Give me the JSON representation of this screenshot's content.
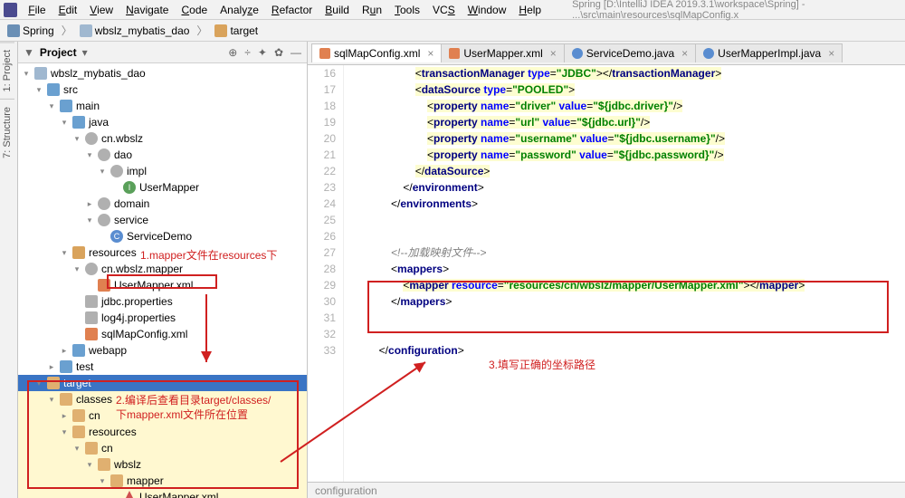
{
  "window_title": "Spring [D:\\IntelliJ IDEA 2019.3.1\\workspace\\Spring] - ...\\src\\main\\resources\\sqlMapConfig.x",
  "menu": [
    "File",
    "Edit",
    "View",
    "Navigate",
    "Code",
    "Analyze",
    "Refactor",
    "Build",
    "Run",
    "Tools",
    "VCS",
    "Window",
    "Help"
  ],
  "breadcrumb": [
    {
      "icon": "ic-project",
      "label": "Spring"
    },
    {
      "icon": "ic-module",
      "label": "wbslz_mybatis_dao"
    },
    {
      "icon": "ic-folder",
      "label": "target"
    }
  ],
  "sidebar_tabs": [
    "1: Project",
    "7: Structure"
  ],
  "project_panel": {
    "title": "Project",
    "tools": [
      "⊕",
      "÷",
      "✦",
      "✿",
      "—"
    ]
  },
  "tree": [
    {
      "d": 0,
      "a": "▾",
      "i": "ic-module",
      "t": "wbslz_mybatis_dao"
    },
    {
      "d": 1,
      "a": "▾",
      "i": "ic-folder-blue",
      "t": "src"
    },
    {
      "d": 2,
      "a": "▾",
      "i": "ic-folder-blue",
      "t": "main"
    },
    {
      "d": 3,
      "a": "▾",
      "i": "ic-folder-blue",
      "t": "java"
    },
    {
      "d": 4,
      "a": "▾",
      "i": "ic-pkg",
      "t": "cn.wbslz"
    },
    {
      "d": 5,
      "a": "▾",
      "i": "ic-pkg",
      "t": "dao"
    },
    {
      "d": 6,
      "a": "▾",
      "i": "ic-pkg",
      "t": "impl"
    },
    {
      "d": 7,
      "a": "",
      "i": "ic-if",
      "it": "I",
      "t": "UserMapper"
    },
    {
      "d": 5,
      "a": "▸",
      "i": "ic-pkg",
      "t": "domain"
    },
    {
      "d": 5,
      "a": "▾",
      "i": "ic-pkg",
      "t": "service"
    },
    {
      "d": 6,
      "a": "",
      "i": "ic-class",
      "it": "C",
      "t": "ServiceDemo"
    },
    {
      "d": 3,
      "a": "▾",
      "i": "ic-folder",
      "t": "resources"
    },
    {
      "d": 4,
      "a": "▾",
      "i": "ic-pkg",
      "t": "cn.wbslz.mapper"
    },
    {
      "d": 5,
      "a": "",
      "i": "ic-xml",
      "t": "UserMapper.xml",
      "box": true
    },
    {
      "d": 4,
      "a": "",
      "i": "ic-props",
      "t": "jdbc.properties"
    },
    {
      "d": 4,
      "a": "",
      "i": "ic-props",
      "t": "log4j.properties"
    },
    {
      "d": 4,
      "a": "",
      "i": "ic-xml",
      "t": "sqlMapConfig.xml"
    },
    {
      "d": 3,
      "a": "▸",
      "i": "ic-folder-blue",
      "t": "webapp"
    },
    {
      "d": 2,
      "a": "▸",
      "i": "ic-folder-blue",
      "t": "test"
    },
    {
      "d": 1,
      "a": "▾",
      "i": "ic-folder-open",
      "t": "target",
      "sel": true
    },
    {
      "d": 2,
      "a": "▾",
      "i": "ic-folder-open",
      "t": "classes",
      "hl": true
    },
    {
      "d": 3,
      "a": "▸",
      "i": "ic-folder-open",
      "t": "cn",
      "hl": true
    },
    {
      "d": 3,
      "a": "▾",
      "i": "ic-folder-open",
      "t": "resources",
      "hl": true
    },
    {
      "d": 4,
      "a": "▾",
      "i": "ic-folder-open",
      "t": "cn",
      "hl": true
    },
    {
      "d": 5,
      "a": "▾",
      "i": "ic-folder-open",
      "t": "wbslz",
      "hl": true
    },
    {
      "d": 6,
      "a": "▾",
      "i": "ic-folder-open",
      "t": "mapper",
      "hl": true
    },
    {
      "d": 7,
      "a": "",
      "i": "ic-err",
      "t": "UserMapper.xml",
      "hl": true
    }
  ],
  "editor_tabs": [
    {
      "icon": "ic-xml",
      "label": "sqlMapConfig.xml",
      "active": true
    },
    {
      "icon": "ic-xml",
      "label": "UserMapper.xml"
    },
    {
      "icon": "ic-java",
      "label": "ServiceDemo.java"
    },
    {
      "icon": "ic-java",
      "label": "UserMapperImpl.java"
    }
  ],
  "code_first_line": 16,
  "code_lines": [
    {
      "ind": 5,
      "html": "<span class='punc'>&lt;</span><span class='tag'>transactionManager </span><span class='attr'>type</span><span class='punc'>=</span><span class='str'>\"JDBC\"</span><span class='punc'>&gt;&lt;/</span><span class='tag'>transactionManager</span><span class='punc'>&gt;</span>",
      "bg": true
    },
    {
      "ind": 5,
      "html": "<span class='punc'>&lt;</span><span class='tag'>dataSource </span><span class='attr'>type</span><span class='punc'>=</span><span class='str'>\"POOLED\"</span><span class='punc'>&gt;</span>",
      "bg": true
    },
    {
      "ind": 6,
      "html": "<span class='punc'>&lt;</span><span class='tag'>property </span><span class='attr'>name</span><span class='punc'>=</span><span class='str'>\"driver\"</span> <span class='attr'>value</span><span class='punc'>=</span><span class='str'>\"${jdbc.driver}\"</span><span class='punc'>/&gt;</span>",
      "bg": true
    },
    {
      "ind": 6,
      "html": "<span class='punc'>&lt;</span><span class='tag'>property </span><span class='attr'>name</span><span class='punc'>=</span><span class='str'>\"url\"</span> <span class='attr'>value</span><span class='punc'>=</span><span class='str'>\"${jdbc.url}\"</span><span class='punc'>/&gt;</span>",
      "bg": true
    },
    {
      "ind": 6,
      "html": "<span class='punc'>&lt;</span><span class='tag'>property </span><span class='attr'>name</span><span class='punc'>=</span><span class='str'>\"username\"</span> <span class='attr'>value</span><span class='punc'>=</span><span class='str'>\"${jdbc.username}\"</span><span class='punc'>/&gt;</span>",
      "bg": true
    },
    {
      "ind": 6,
      "html": "<span class='punc'>&lt;</span><span class='tag'>property </span><span class='attr'>name</span><span class='punc'>=</span><span class='str'>\"password\"</span> <span class='attr'>value</span><span class='punc'>=</span><span class='str'>\"${jdbc.password}\"</span><span class='punc'>/&gt;</span>",
      "bg": true
    },
    {
      "ind": 5,
      "html": "<span class='punc'>&lt;/</span><span class='tag'>dataSource</span><span class='punc'>&gt;</span>",
      "bg": true
    },
    {
      "ind": 4,
      "html": "<span class='punc'>&lt;/</span><span class='tag'>environment</span><span class='punc'>&gt;</span>"
    },
    {
      "ind": 3,
      "html": "<span class='punc'>&lt;/</span><span class='tag'>environments</span><span class='punc'>&gt;</span>"
    },
    {
      "ind": 0,
      "html": ""
    },
    {
      "ind": 0,
      "html": "",
      "bg": true
    },
    {
      "ind": 3,
      "html": "<span class='comment'>&lt;!--加载映射文件--&gt;</span>"
    },
    {
      "ind": 3,
      "html": "<span class='punc'>&lt;</span><span class='tag'>mappers</span><span class='punc'>&gt;</span>"
    },
    {
      "ind": 4,
      "html": "<span class='punc'>&lt;</span><span class='tag'>mapper </span><span class='attr'>resource</span><span class='punc'>=</span><span class='str'>\"resources/cn/wbslz/mapper/UserMapper.xml\"</span><span class='punc'>&gt;&lt;/</span><span class='tag'>mapper</span><span class='punc'>&gt;</span>",
      "bg": true
    },
    {
      "ind": 3,
      "html": "<span class='punc'>&lt;/</span><span class='tag'>mappers</span><span class='punc'>&gt;</span>"
    },
    {
      "ind": 0,
      "html": ""
    },
    {
      "ind": 0,
      "html": ""
    },
    {
      "ind": 2,
      "html": "<span class='punc'>&lt;/</span><span class='tag'>configuration</span><span class='punc'>&gt;</span>"
    }
  ],
  "status_text": "configuration",
  "annotations": {
    "a1": "1.mapper文件在resources下",
    "a2": "2.编译后查看目录target/classes/下mapper.xml文件所在位置",
    "a3": "3.填写正确的坐标路径"
  }
}
